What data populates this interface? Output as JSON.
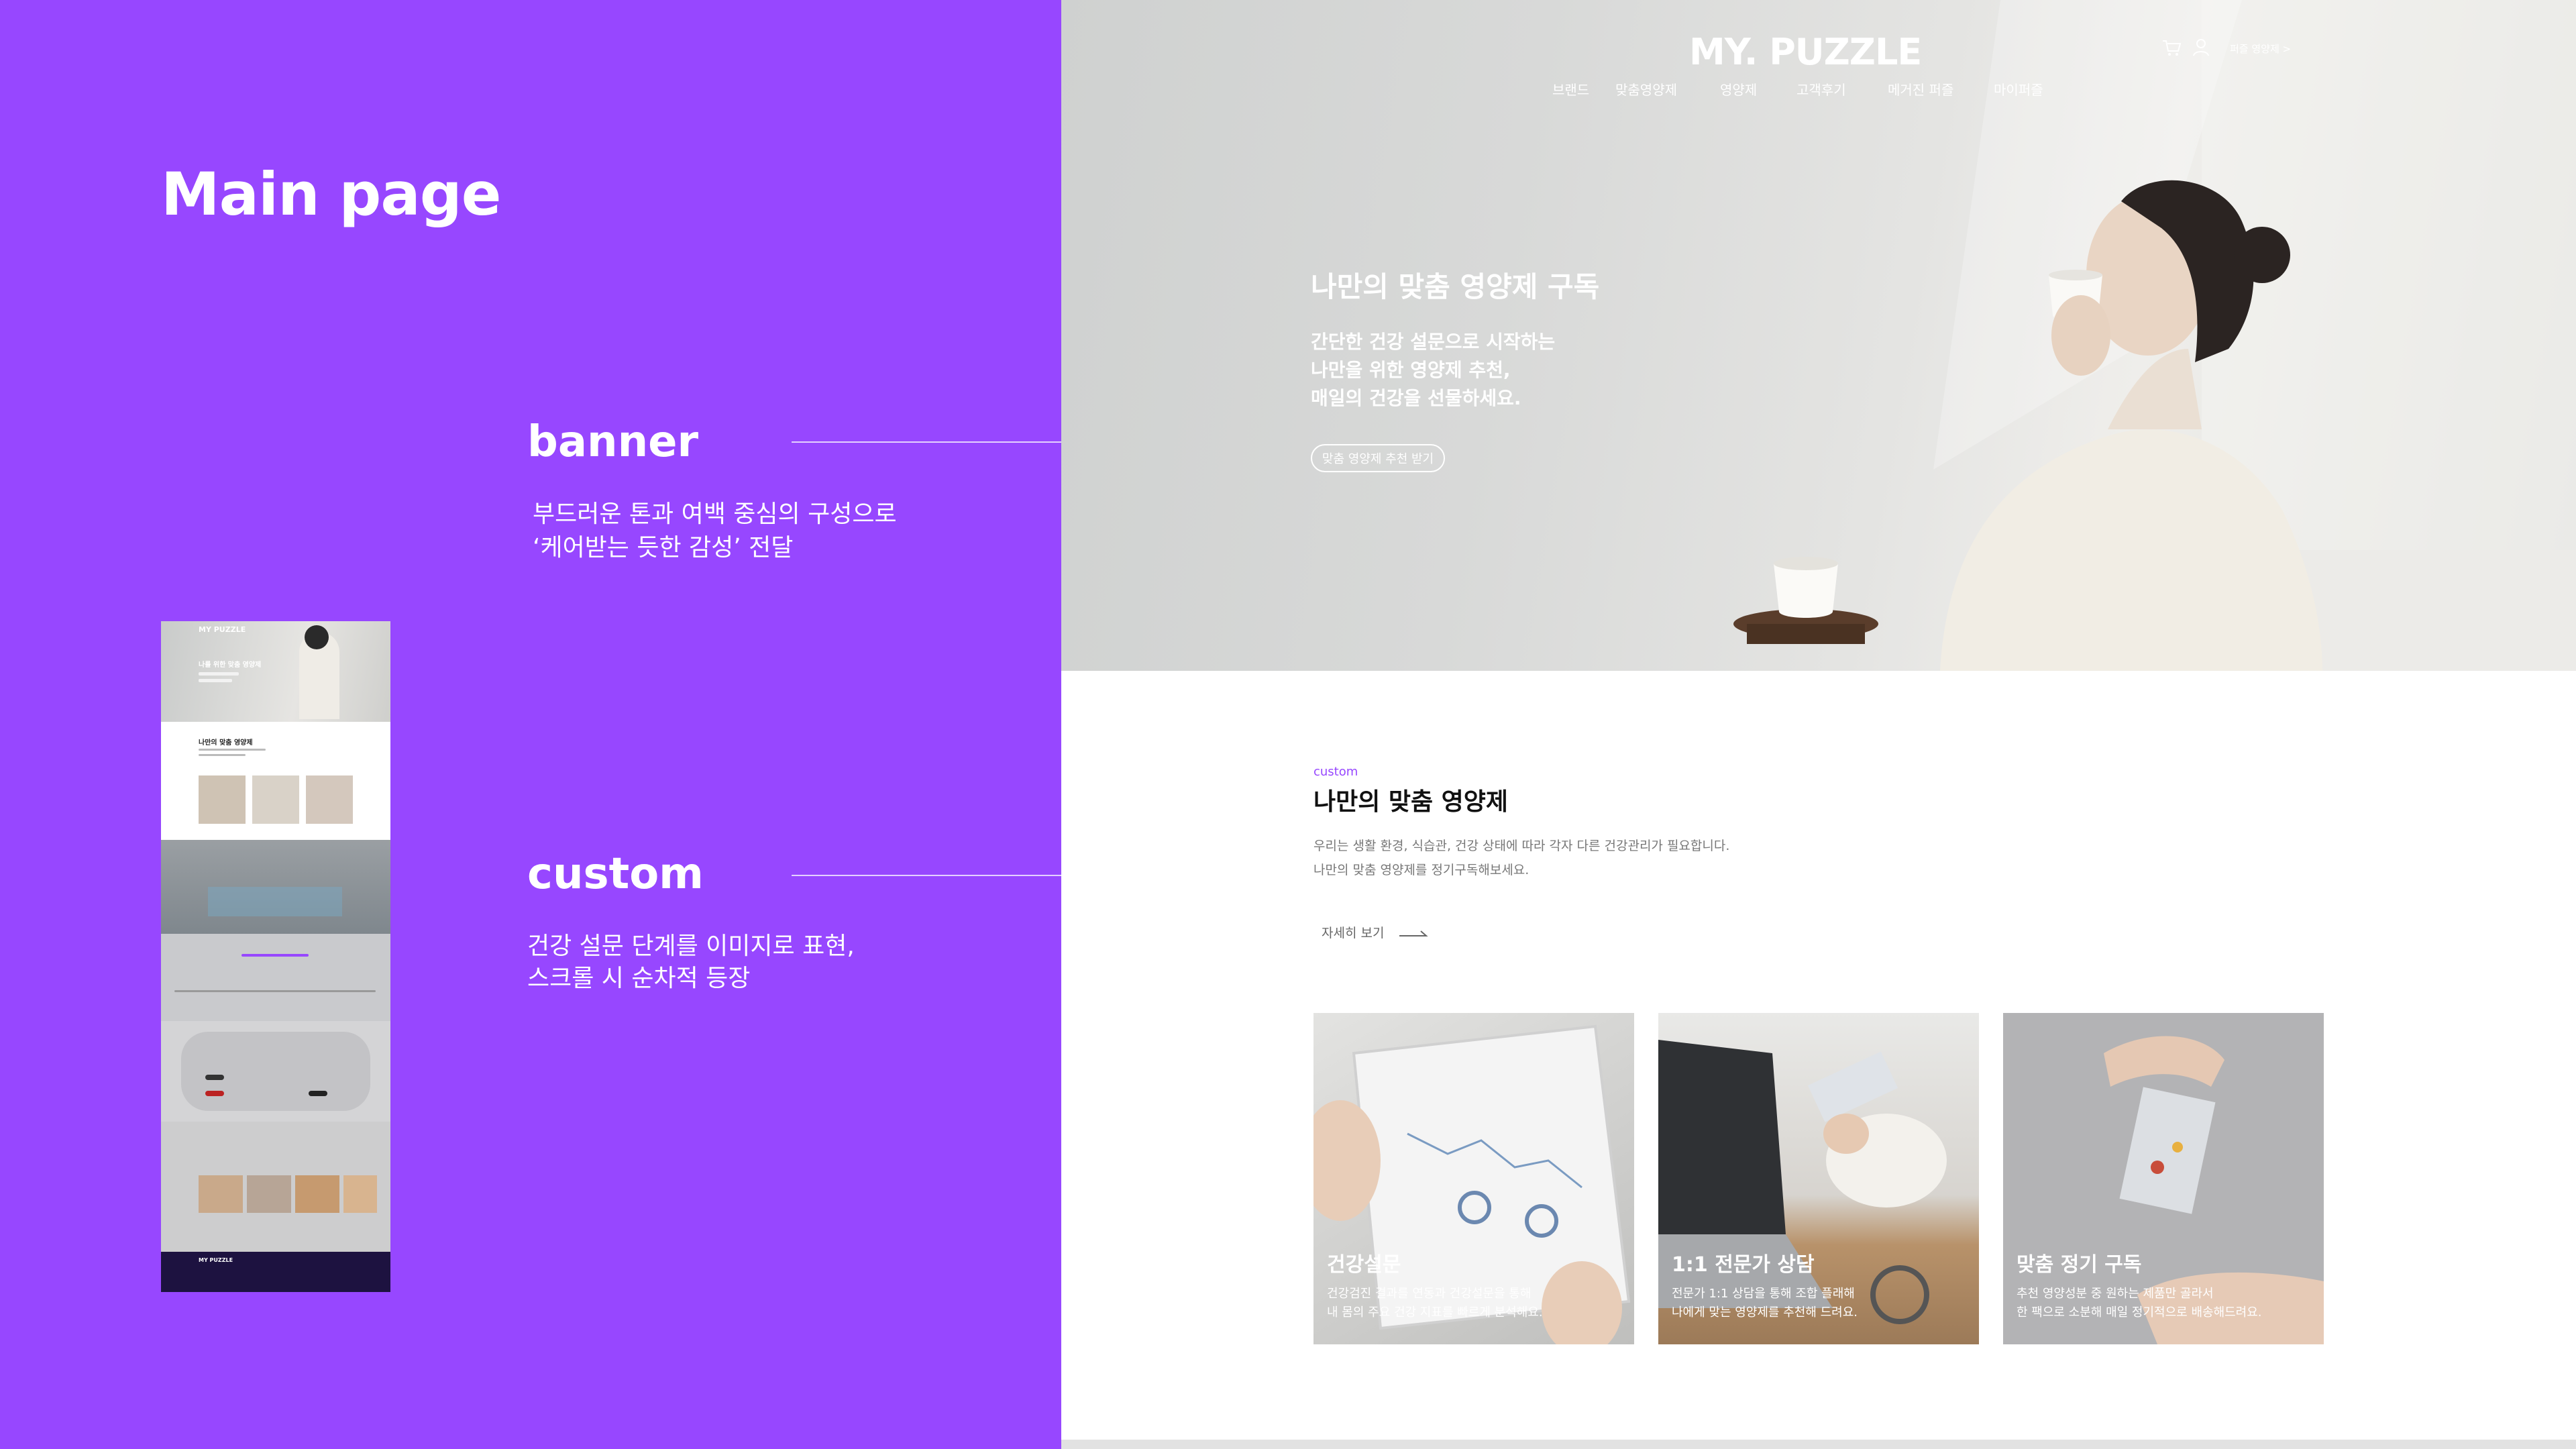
{
  "panel": {
    "heading": "Main page",
    "sections": [
      {
        "title": "banner",
        "desc_lines": [
          "부드러운 톤과 여백 중심의 구성으로",
          "‘케어받는 듯한 감성’ 전달"
        ]
      },
      {
        "title": "custom",
        "desc_lines": [
          "건강 설문 단계를 이미지로 표현,",
          "스크롤 시 순차적 등장"
        ]
      }
    ]
  },
  "thumbnail": {
    "logo": "MY PUZZLE",
    "hero_text": "나를 위한 맞춤 영양제",
    "custom_text": "나만의 맞춤 영양제"
  },
  "site": {
    "logo": "MY. PUZZLE",
    "nav": [
      "브랜드",
      "맞춤영양제",
      "영양제",
      "고객후기",
      "메거진 퍼즐",
      "마이퍼즐"
    ],
    "utility": {
      "cart_icon": "cart-icon",
      "user_icon": "user-icon",
      "link_label": "퍼즐 영양제 >"
    },
    "hero": {
      "title": "나만의 맞춤 영양제 구독",
      "subtitle_lines": [
        "간단한 건강 설문으로 시작하는",
        "나만을 위한 영양제 추천,",
        "매일의 건강을 선물하세요."
      ],
      "cta": "맞춤 영양제 추천 받기"
    },
    "custom": {
      "kicker": "custom",
      "heading": "나만의 맞춤 영양제",
      "desc_lines": [
        "우리는 생활 환경, 식습관, 건강 상태에 따라 각자 다른 건강관리가 필요합니다.",
        "나만의 맞춤 영양제를 정기구독해보세요."
      ],
      "more": "자세히 보기",
      "cards": [
        {
          "title": "건강설문",
          "desc_lines": [
            "건강검진 결과를 연동과 건강설문을 통해",
            " 내 몸의 주요 건강 지표를 빠르게 분석해요."
          ]
        },
        {
          "title": "1:1 전문가 상담",
          "desc_lines": [
            "전문가 1:1 상담을 통해  조합 플래해",
            "나에게 맞는 영양제를 추천해 드려요."
          ]
        },
        {
          "title": "맞춤 정기 구독",
          "desc_lines": [
            "추천 영양성분 중 원하는 제품만 골라서",
            "한 팩으로 소분해 매일 정기적으로 배송해드려요."
          ]
        }
      ]
    }
  },
  "colors": {
    "accent": "#9747ff",
    "white": "#ffffff"
  }
}
